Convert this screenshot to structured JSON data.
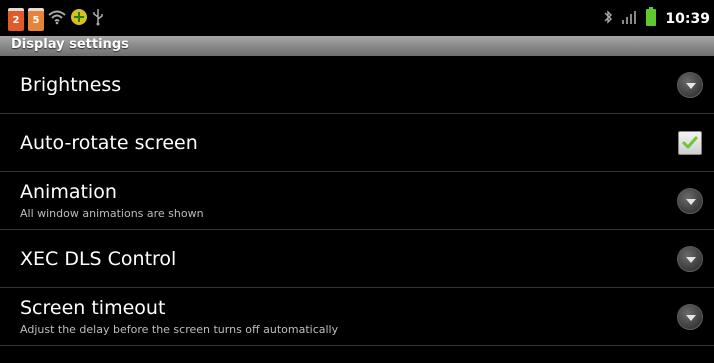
{
  "status_bar": {
    "notifications": [
      {
        "icon": "calendar-notification-icon",
        "label": "2",
        "color": "#e25a2a"
      },
      {
        "icon": "app-notification-icon",
        "label": "5",
        "color": "#e8833a"
      },
      {
        "icon": "wifi-icon"
      },
      {
        "icon": "android-update-icon"
      },
      {
        "icon": "usb-icon"
      }
    ],
    "system_icons": [
      "bluetooth-icon",
      "signal-icon",
      "battery-icon"
    ],
    "time": "10:39"
  },
  "title_bar": {
    "title": "Display settings"
  },
  "settings": [
    {
      "title": "Brightness",
      "summary": "",
      "control": "dropdown"
    },
    {
      "title": "Auto-rotate screen",
      "summary": "",
      "control": "checkbox",
      "checked": true
    },
    {
      "title": "Animation",
      "summary": "All window animations are shown",
      "control": "dropdown"
    },
    {
      "title": "XEC DLS Control",
      "summary": "",
      "control": "dropdown"
    },
    {
      "title": "Screen timeout",
      "summary": "Adjust the delay before the screen turns off automatically",
      "control": "dropdown"
    }
  ],
  "colors": {
    "accent_green": "#7fd13b",
    "title_bar": "#8c8c8c",
    "battery": "#5ec82e"
  }
}
